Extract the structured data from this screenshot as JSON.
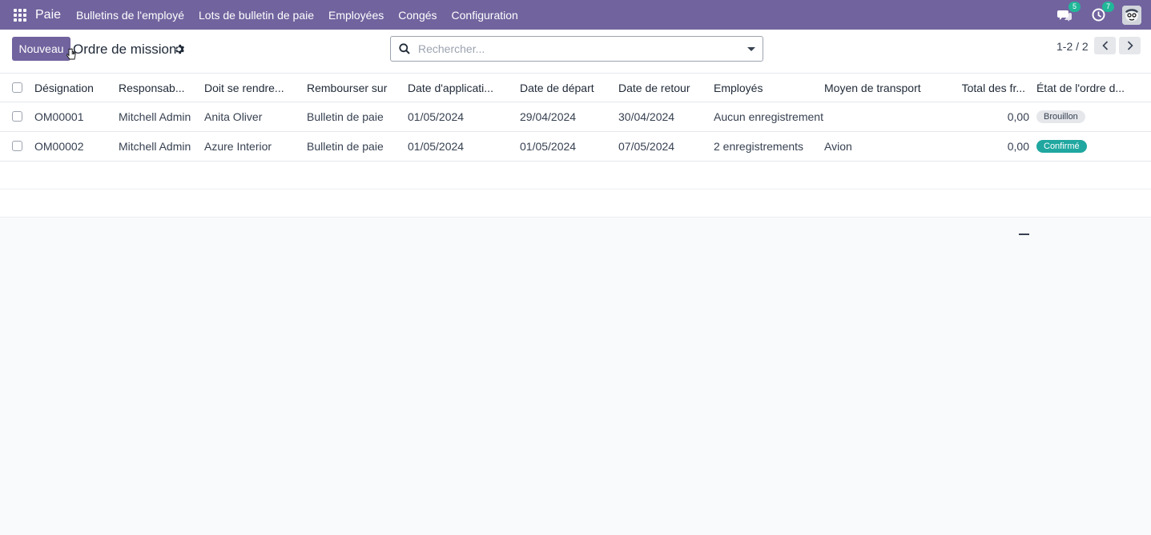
{
  "nav": {
    "brand": "Paie",
    "items": [
      "Bulletins de l'employé",
      "Lots de bulletin de paie",
      "Employées",
      "Congés",
      "Configuration"
    ],
    "messages_badge": "5",
    "activities_badge": "7"
  },
  "control": {
    "new_label": "Nouveau",
    "title": "Ordre de mission",
    "search_placeholder": "Rechercher...",
    "pager": "1-2 / 2"
  },
  "table": {
    "headers": [
      "Désignation",
      "Responsab...",
      "Doit se rendre...",
      "Rembourser sur",
      "Date d'applicati...",
      "Date de départ",
      "Date de retour",
      "Employés",
      "Moyen de transport",
      "Total des fr...",
      "État de l'ordre d..."
    ],
    "rows": [
      {
        "designation": "OM00001",
        "responsable": "Mitchell Admin",
        "destination": "Anita Oliver",
        "rembourser": "Bulletin de paie",
        "date_application": "01/05/2024",
        "date_depart": "29/04/2024",
        "date_retour": "30/04/2024",
        "employes": "Aucun enregistrement",
        "transport": "",
        "total": "0,00",
        "etat": "Brouillon"
      },
      {
        "designation": "OM00002",
        "responsable": "Mitchell Admin",
        "destination": "Azure Interior",
        "rembourser": "Bulletin de paie",
        "date_application": "01/05/2024",
        "date_depart": "01/05/2024",
        "date_retour": "07/05/2024",
        "employes": "2 enregistrements",
        "transport": "Avion",
        "total": "0,00",
        "etat": "Confirmé"
      }
    ]
  },
  "colors": {
    "primary": "#71639e",
    "badge": "#21b799",
    "confirmed": "#1fa7a0"
  }
}
